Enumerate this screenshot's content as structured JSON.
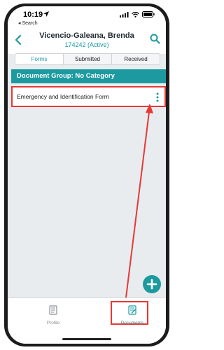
{
  "status_bar": {
    "time": "10:19",
    "back_app_label": "◂ Search",
    "icons": [
      "location-arrow-icon",
      "signal-icon",
      "wifi-icon",
      "battery-icon"
    ]
  },
  "header": {
    "title": "Vicencio-Galeana, Brenda",
    "subtitle": "174242 (Active)",
    "back_icon": "chevron-left-icon",
    "search_icon": "search-icon"
  },
  "tabs": [
    {
      "label": "Forms",
      "active": true
    },
    {
      "label": "Submitted",
      "active": false
    },
    {
      "label": "Received",
      "active": false
    }
  ],
  "document_group": {
    "title": "Document Group: No Category",
    "items": [
      {
        "label": "Emergency and Identification Form",
        "menu_icon": "more-vertical-icon"
      }
    ]
  },
  "fab": {
    "icon": "plus-icon"
  },
  "bottom_nav": {
    "items": [
      {
        "label": "Profile",
        "icon": "profile-document-icon",
        "active": false
      },
      {
        "label": "Documents",
        "icon": "documents-icon",
        "active": true
      }
    ]
  },
  "colors": {
    "accent": "#1c9aa0",
    "annotation": "#e53935",
    "background": "#e9ecef"
  }
}
